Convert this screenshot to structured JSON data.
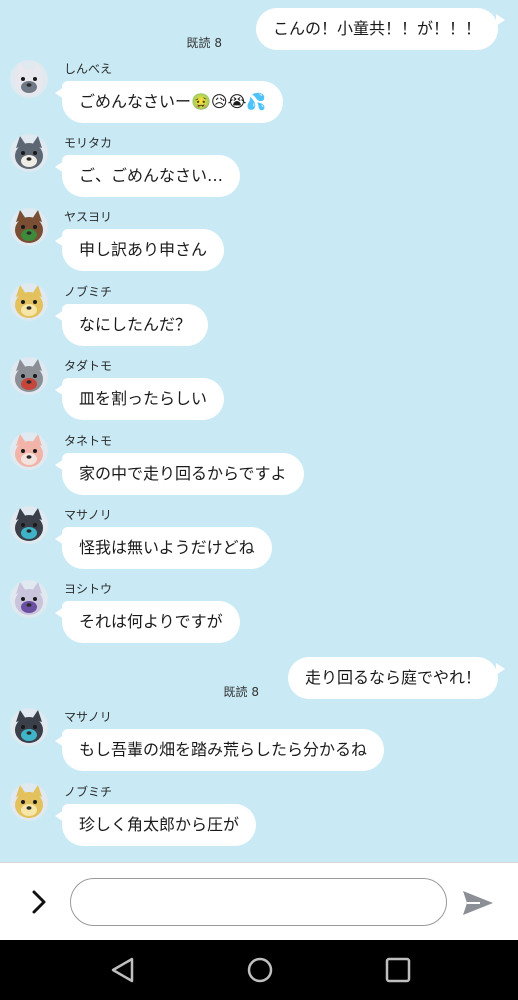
{
  "chat": {
    "background": "#c9eaf5",
    "messages": [
      {
        "side": "out",
        "text": "こんの！小童共！！が！！！",
        "read": "既読 8"
      },
      {
        "side": "in",
        "sender": "しんべえ",
        "text": "ごめんなさいー🤢😥😭💦",
        "avatar": {
          "icon": "avatar-shinbee",
          "fur": "#e8e8ee",
          "accent": "#6f7a86"
        }
      },
      {
        "side": "in",
        "sender": "モリタカ",
        "text": "ご、ごめんなさい…",
        "avatar": {
          "icon": "avatar-moritaka",
          "fur": "#5d6673",
          "accent": "#f0ece6"
        }
      },
      {
        "side": "in",
        "sender": "ヤスヨリ",
        "text": "申し訳あり申さん",
        "avatar": {
          "icon": "avatar-yasuyori",
          "fur": "#7a4e33",
          "accent": "#3d8a3a"
        }
      },
      {
        "side": "in",
        "sender": "ノブミチ",
        "text": "なにしたんだ？",
        "avatar": {
          "icon": "avatar-nobumichi",
          "fur": "#e3c25e",
          "accent": "#f6e7a8"
        }
      },
      {
        "side": "in",
        "sender": "タダトモ",
        "text": "皿を割ったらしい",
        "avatar": {
          "icon": "avatar-tadatomo",
          "fur": "#8c8e96",
          "accent": "#c7463c"
        }
      },
      {
        "side": "in",
        "sender": "タネトモ",
        "text": "家の中で走り回るからですよ",
        "avatar": {
          "icon": "avatar-tanetomo",
          "fur": "#f2b4a8",
          "accent": "#f4e3dc"
        }
      },
      {
        "side": "in",
        "sender": "マサノリ",
        "text": "怪我は無いようだけどね",
        "avatar": {
          "icon": "avatar-masanori",
          "fur": "#3a3f4a",
          "accent": "#3fb4c9"
        }
      },
      {
        "side": "in",
        "sender": "ヨシトウ",
        "text": "それは何よりですが",
        "avatar": {
          "icon": "avatar-yoshitou",
          "fur": "#c9c3dc",
          "accent": "#6b4fa0"
        }
      },
      {
        "side": "out",
        "text": "走り回るなら庭でやれ！",
        "read": "既読 8"
      },
      {
        "side": "in",
        "sender": "マサノリ",
        "text": "もし吾輩の畑を踏み荒らしたら分かるね",
        "avatar": {
          "icon": "avatar-masanori",
          "fur": "#3a3f4a",
          "accent": "#3fb4c9"
        }
      },
      {
        "side": "in",
        "sender": "ノブミチ",
        "text": "珍しく角太郎から圧が",
        "avatar": {
          "icon": "avatar-nobumichi",
          "fur": "#e3c25e",
          "accent": "#f6e7a8"
        }
      }
    ]
  },
  "input": {
    "placeholder": "",
    "value": ""
  },
  "icons": {
    "expand": "chevron-right-icon",
    "send": "send-icon"
  },
  "navbar": {
    "back": "back-icon",
    "home": "home-icon",
    "recents": "recents-icon"
  }
}
